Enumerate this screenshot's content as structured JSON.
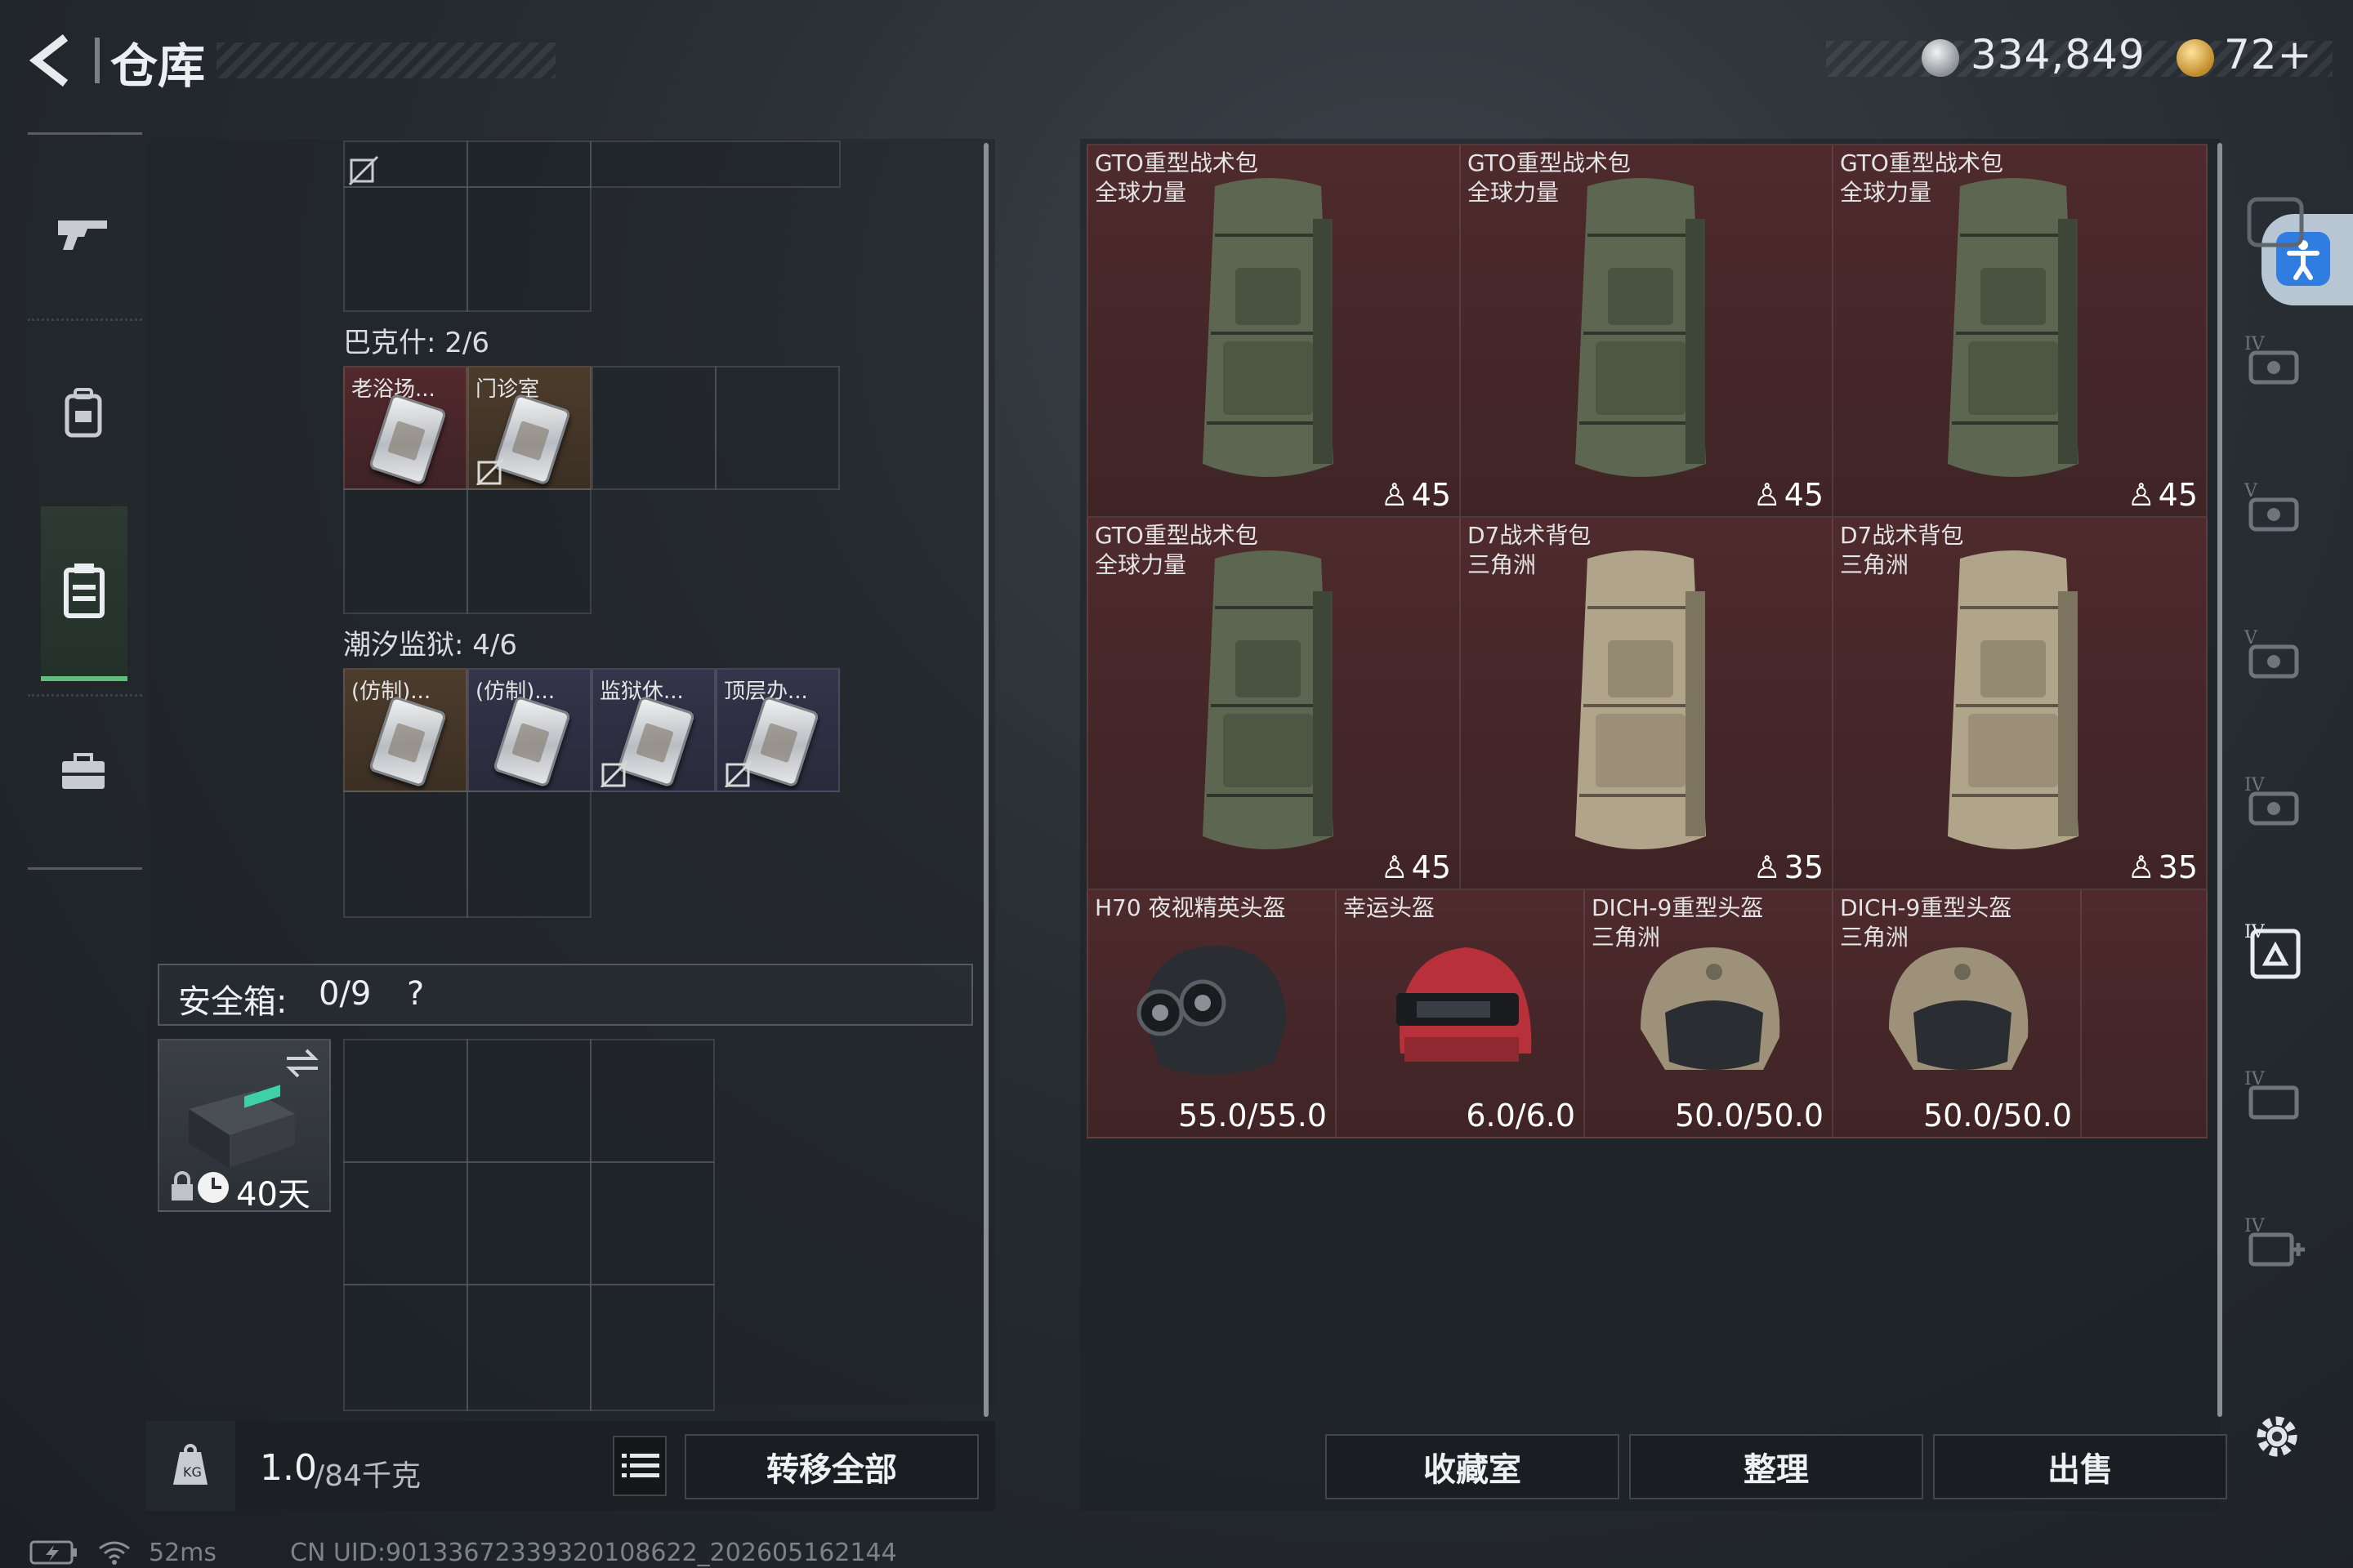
{
  "header": {
    "back_label": "<",
    "title": "仓库",
    "currency_main": "334,849",
    "currency_secondary": "72+"
  },
  "sidebar": {
    "items": [
      {
        "icon": "gun-icon"
      },
      {
        "icon": "backpack-icon"
      },
      {
        "icon": "vest-icon",
        "active": true
      },
      {
        "icon": "briefcase-icon"
      }
    ]
  },
  "left_panel": {
    "sections": [
      {
        "label": "巴克什: 2/6",
        "items": [
          "老浴场...",
          "门诊室"
        ]
      },
      {
        "label": "潮汐监狱: 4/6",
        "items": [
          "(仿制)...",
          "(仿制)...",
          "监狱休...",
          "顶层办..."
        ]
      }
    ],
    "safe_box": {
      "label": "安全箱:",
      "count": "0/9",
      "help": "?",
      "days": "40天"
    },
    "footer": {
      "weight_value": "1.0",
      "weight_capacity": "/84千克",
      "transfer_all": "转移全部"
    }
  },
  "inventory": {
    "backpacks": [
      {
        "name1": "GTO重型战术包",
        "name2": "全球力量",
        "capacity": "45",
        "color": "olive"
      },
      {
        "name1": "GTO重型战术包",
        "name2": "全球力量",
        "capacity": "45",
        "color": "olive"
      },
      {
        "name1": "GTO重型战术包",
        "name2": "全球力量",
        "capacity": "45",
        "color": "olive"
      },
      {
        "name1": "GTO重型战术包",
        "name2": "全球力量",
        "capacity": "45",
        "color": "olive"
      },
      {
        "name1": "D7战术背包",
        "name2": "三角洲",
        "capacity": "35",
        "color": "tan"
      },
      {
        "name1": "D7战术背包",
        "name2": "三角洲",
        "capacity": "35",
        "color": "tan"
      }
    ],
    "helmets": [
      {
        "name1": "H70 夜视精英头盔",
        "name2": "",
        "durability": "55.0/55.0"
      },
      {
        "name1": "幸运头盔",
        "name2": "",
        "durability": "6.0/6.0"
      },
      {
        "name1": "DICH-9重型头盔",
        "name2": "三角洲",
        "durability": "50.0/50.0"
      },
      {
        "name1": "DICH-9重型头盔",
        "name2": "三角洲",
        "durability": "50.0/50.0"
      }
    ],
    "actions": {
      "collection": "收藏室",
      "sort": "整理",
      "sell": "出售"
    }
  },
  "status_bar": {
    "ping": "52ms",
    "uid": "CN UID:9013367233932010862​2_202605162144"
  },
  "colors": {
    "accent_green": "#5fbf7a",
    "item_red": "#4e2a2c",
    "accessibility_blue": "#2f7de1"
  }
}
